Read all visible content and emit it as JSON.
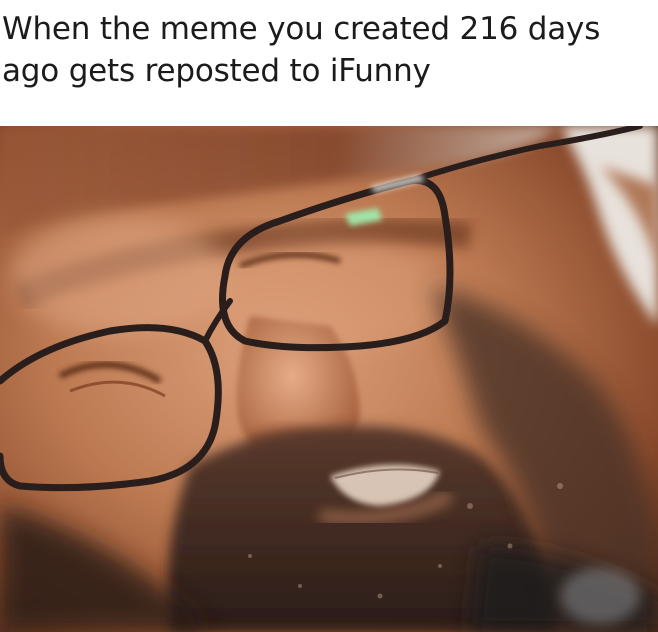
{
  "caption": {
    "text": "When the meme you created 216 days\nago gets reposted to iFunny"
  },
  "image": {
    "subject": "man-grimacing-closeup",
    "colors": {
      "skin": "#b8734c",
      "skin_light": "#d99a72",
      "skin_dark": "#6e3a22",
      "beard": "#3a2a22",
      "glasses_frame": "#2a1e1c",
      "lens_glint": "#9ef0b0",
      "background_dark": "#1c1a1c",
      "background_light": "#f1ede9"
    }
  }
}
